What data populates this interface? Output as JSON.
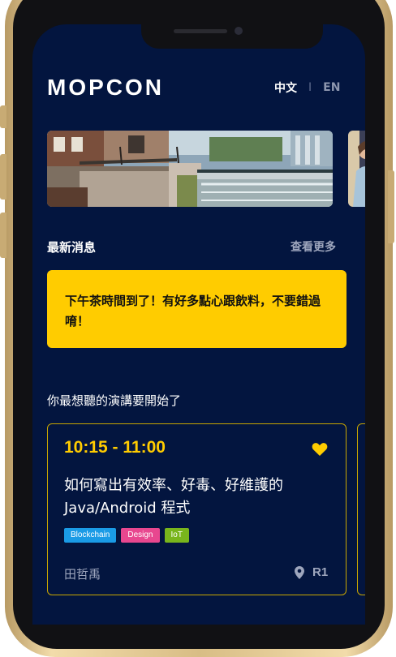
{
  "brand": {
    "logo": "MOPCON"
  },
  "language": {
    "active": "中文",
    "separator": "I",
    "inactive": "EN"
  },
  "news": {
    "title": "最新消息",
    "more_link": "查看更多",
    "items": [
      {
        "text": "下午茶時間到了！有好多點心跟飲料，不要錯過唷！"
      }
    ]
  },
  "upcoming": {
    "title": "你最想聽的演講要開始了",
    "talks": [
      {
        "time": "10:15 - 11:00",
        "title": "如何寫出有效率、好毒、好維護的Java/Android 程式",
        "favorite": true,
        "tags": [
          {
            "label": "Blockchain",
            "color": "#1a9be6"
          },
          {
            "label": "Design",
            "color": "#e8478f"
          },
          {
            "label": "IoT",
            "color": "#79b51c"
          }
        ],
        "speaker": "田哲禹",
        "room": "R1"
      }
    ]
  },
  "colors": {
    "background": "#03153f",
    "accent": "#ffcc00",
    "muted_text": "#9ea6bd"
  },
  "icons": {
    "favorite": "heart-icon",
    "location": "location-pin-icon"
  }
}
